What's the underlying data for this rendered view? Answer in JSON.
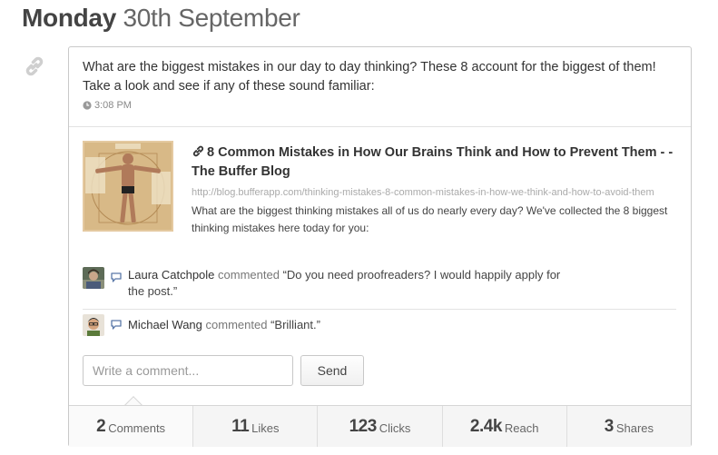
{
  "date": {
    "day": "Monday",
    "rest": "30th September"
  },
  "icons": {
    "side": "link-chain-icon",
    "time": "clock-icon",
    "comment": "speech-bubble-icon",
    "title": "link-chain-icon"
  },
  "post": {
    "text": "What are the biggest mistakes in our day to day thinking? These 8 account for the biggest of them! Take a look and see if any of these sound familiar:",
    "time": "3:08 PM"
  },
  "link": {
    "title": "8 Common Mistakes in How Our Brains Think and How to Prevent Them - - The Buffer Blog",
    "url": "http://blog.bufferapp.com/thinking-mistakes-8-common-mistakes-in-how-we-think-and-how-to-avoid-them",
    "description": "What are the biggest thinking mistakes all of us do nearly every day? We've collected the 8 biggest thinking mistakes here today for you:"
  },
  "comments": [
    {
      "author": "Laura Catchpole",
      "verb": "commented",
      "text": "“Do you need proofreaders? I would happily apply for the post.”"
    },
    {
      "author": "Michael Wang",
      "verb": "commented",
      "text": "“Brilliant.”"
    }
  ],
  "comment_box": {
    "placeholder": "Write a comment...",
    "send_label": "Send"
  },
  "stats": [
    {
      "value": "2",
      "label": "Comments"
    },
    {
      "value": "11",
      "label": "Likes"
    },
    {
      "value": "123",
      "label": "Clicks"
    },
    {
      "value": "2.4k",
      "label": "Reach"
    },
    {
      "value": "3",
      "label": "Shares"
    }
  ]
}
